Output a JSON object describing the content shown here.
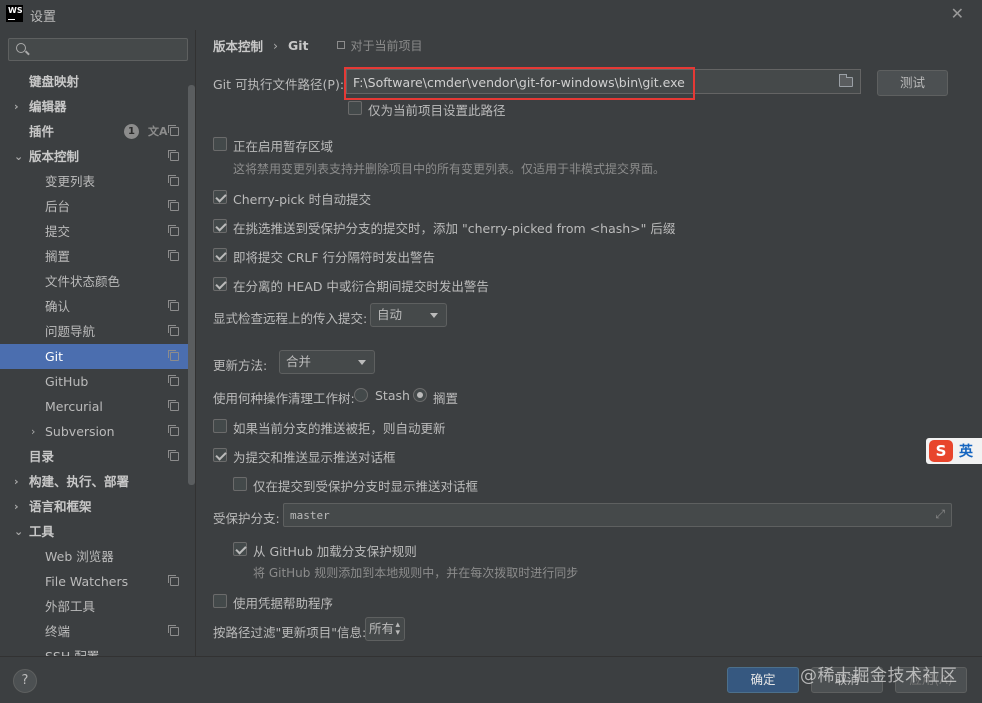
{
  "window": {
    "title": "设置",
    "logo_text": "WS"
  },
  "search": {
    "placeholder": "",
    "value": ""
  },
  "sidebar": {
    "items": [
      {
        "label": "键盘映射"
      },
      {
        "label": "编辑器"
      },
      {
        "label": "插件",
        "badge": "1"
      },
      {
        "label": "版本控制"
      },
      {
        "label": "变更列表"
      },
      {
        "label": "后台"
      },
      {
        "label": "提交"
      },
      {
        "label": "搁置"
      },
      {
        "label": "文件状态颜色"
      },
      {
        "label": "确认"
      },
      {
        "label": "问题导航"
      },
      {
        "label": "Git"
      },
      {
        "label": "GitHub"
      },
      {
        "label": "Mercurial"
      },
      {
        "label": "Subversion"
      },
      {
        "label": "目录"
      },
      {
        "label": "构建、执行、部署"
      },
      {
        "label": "语言和框架"
      },
      {
        "label": "工具"
      },
      {
        "label": "Web 浏览器"
      },
      {
        "label": "File Watchers"
      },
      {
        "label": "外部工具"
      },
      {
        "label": "终端"
      },
      {
        "label": "SSH 配置"
      }
    ]
  },
  "breadcrumb": {
    "parent": "版本控制",
    "separator": "›",
    "current": "Git",
    "scope": "对于当前项目"
  },
  "git": {
    "path_label": "Git 可执行文件路径(P):",
    "path_value": "F:\\Software\\cmder\\vendor\\git-for-windows\\bin\\git.exe",
    "test_button": "测试",
    "project_only_label": "仅为当前项目设置此路径",
    "project_only_checked": false
  },
  "options": {
    "staging_area": {
      "label": "正在启用暂存区域",
      "checked": false
    },
    "staging_hint": "这将禁用变更列表支持并删除项目中的所有变更列表。仅适用于非模式提交界面。",
    "cherry_pick_auto": {
      "label": "Cherry-pick 时自动提交",
      "checked": true
    },
    "cherry_pick_suffix": {
      "label": "在挑选推送到受保护分支的提交时，添加 \"cherry-picked from <hash>\" 后缀",
      "checked": true
    },
    "crlf_warn": {
      "label": "即将提交 CRLF 行分隔符时发出警告",
      "checked": true
    },
    "detached_head_warn": {
      "label": "在分离的 HEAD 中或衍合期间提交时发出警告",
      "checked": true
    },
    "incoming_check_label": "显式检查远程上的传入提交:",
    "incoming_check_value": "自动",
    "update_method_label": "更新方法:",
    "update_method_value": "合并",
    "cleanup_label": "使用何种操作清理工作树:",
    "cleanup_stash": "Stash",
    "cleanup_shelve": "搁置",
    "cleanup_selected": "shelve",
    "auto_update_rejected": {
      "label": "如果当前分支的推送被拒，则自动更新",
      "checked": false
    },
    "push_dialog": {
      "label": "为提交和推送显示推送对话框",
      "checked": true
    },
    "push_dialog_protected": {
      "label": "仅在提交到受保护分支时显示推送对话框",
      "checked": false
    },
    "protected_branches_label": "受保护分支:",
    "protected_branches_value": "master",
    "github_rules": {
      "label": "从 GitHub 加载分支保护规则",
      "checked": true
    },
    "github_rules_hint": "将 GitHub 规则添加到本地规则中，并在每次拨取时进行同步",
    "credential_helper": {
      "label": "使用凭据帮助程序",
      "checked": false
    },
    "filter_label": "按路径过滤\"更新项目\"信息:",
    "filter_value": "所有"
  },
  "footer": {
    "ok": "确定",
    "cancel": "取消",
    "apply": "应用(A)",
    "help": "?",
    "watermark": "@稀土掘金技术社区"
  },
  "ime": {
    "logo": "S",
    "mode": "英"
  }
}
